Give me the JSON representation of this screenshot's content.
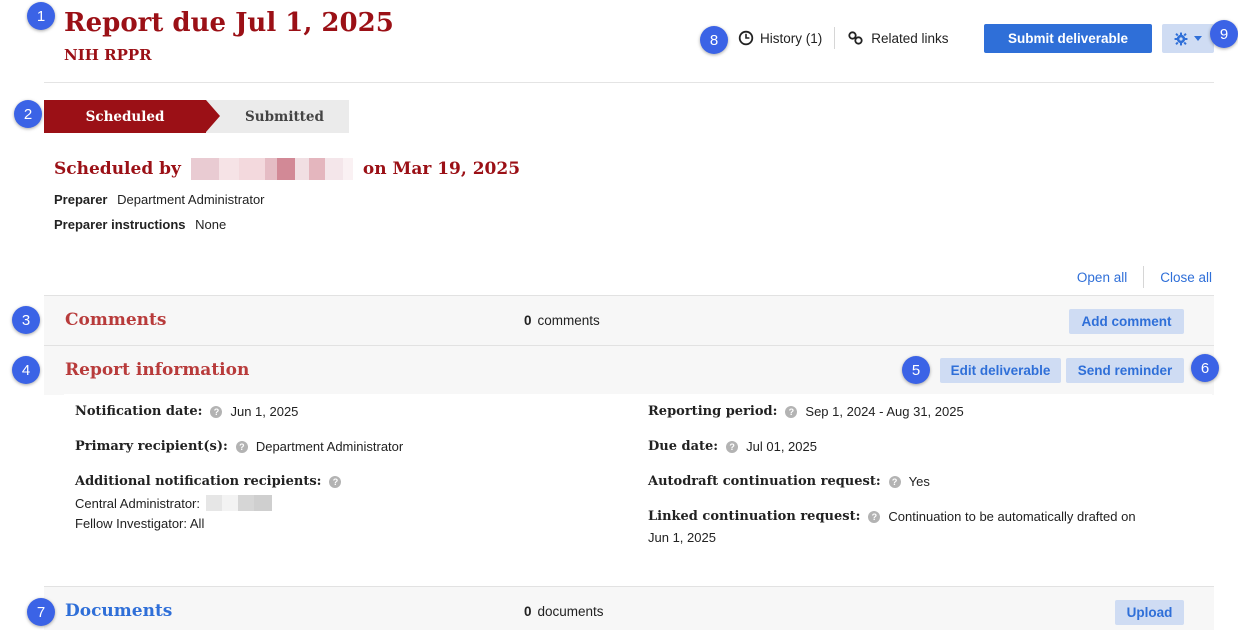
{
  "callouts": [
    "1",
    "2",
    "3",
    "4",
    "5",
    "6",
    "7",
    "8",
    "9"
  ],
  "header": {
    "title": "Report due Jul 1, 2025",
    "subtitle": "NIH RPPR",
    "history_label": "History (1)",
    "related_links_label": "Related links",
    "submit_label": "Submit deliverable"
  },
  "steps": {
    "active": "Scheduled",
    "next": "Submitted"
  },
  "scheduled": {
    "prefix": "Scheduled by",
    "suffix": "on Mar 19, 2025",
    "preparer_label": "Preparer",
    "preparer_value": "Department Administrator",
    "instructions_label": "Preparer instructions",
    "instructions_value": "None"
  },
  "toggles": {
    "open_all": "Open all",
    "close_all": "Close all"
  },
  "comments": {
    "title": "Comments",
    "count": "0",
    "count_label": "comments",
    "button": "Add comment"
  },
  "report": {
    "title": "Report information",
    "edit_button": "Edit deliverable",
    "reminder_button": "Send reminder",
    "notification_label": "Notification date:",
    "notification_value": "Jun 1, 2025",
    "primary_label": "Primary recipient(s):",
    "primary_value": "Department Administrator",
    "additional_label": "Additional notification recipients:",
    "central_label": "Central Administrator:",
    "fellow_label": "Fellow Investigator: All",
    "reporting_label": "Reporting period:",
    "reporting_value": "Sep 1, 2024 - Aug 31, 2025",
    "due_label": "Due date:",
    "due_value": "Jul 01, 2025",
    "autodraft_label": "Autodraft continuation request:",
    "autodraft_value": "Yes",
    "linked_label": "Linked continuation request:",
    "linked_value_1": "Continuation to be automatically drafted on",
    "linked_value_2": "Jun 1, 2025"
  },
  "documents": {
    "title": "Documents",
    "count": "0",
    "count_label": "documents",
    "button": "Upload"
  },
  "colors": {
    "brand_red": "#9b1016",
    "primary_blue": "#2f6fd8",
    "soft_blue": "#cfdcf3",
    "callout_blue": "#3b63e6"
  }
}
